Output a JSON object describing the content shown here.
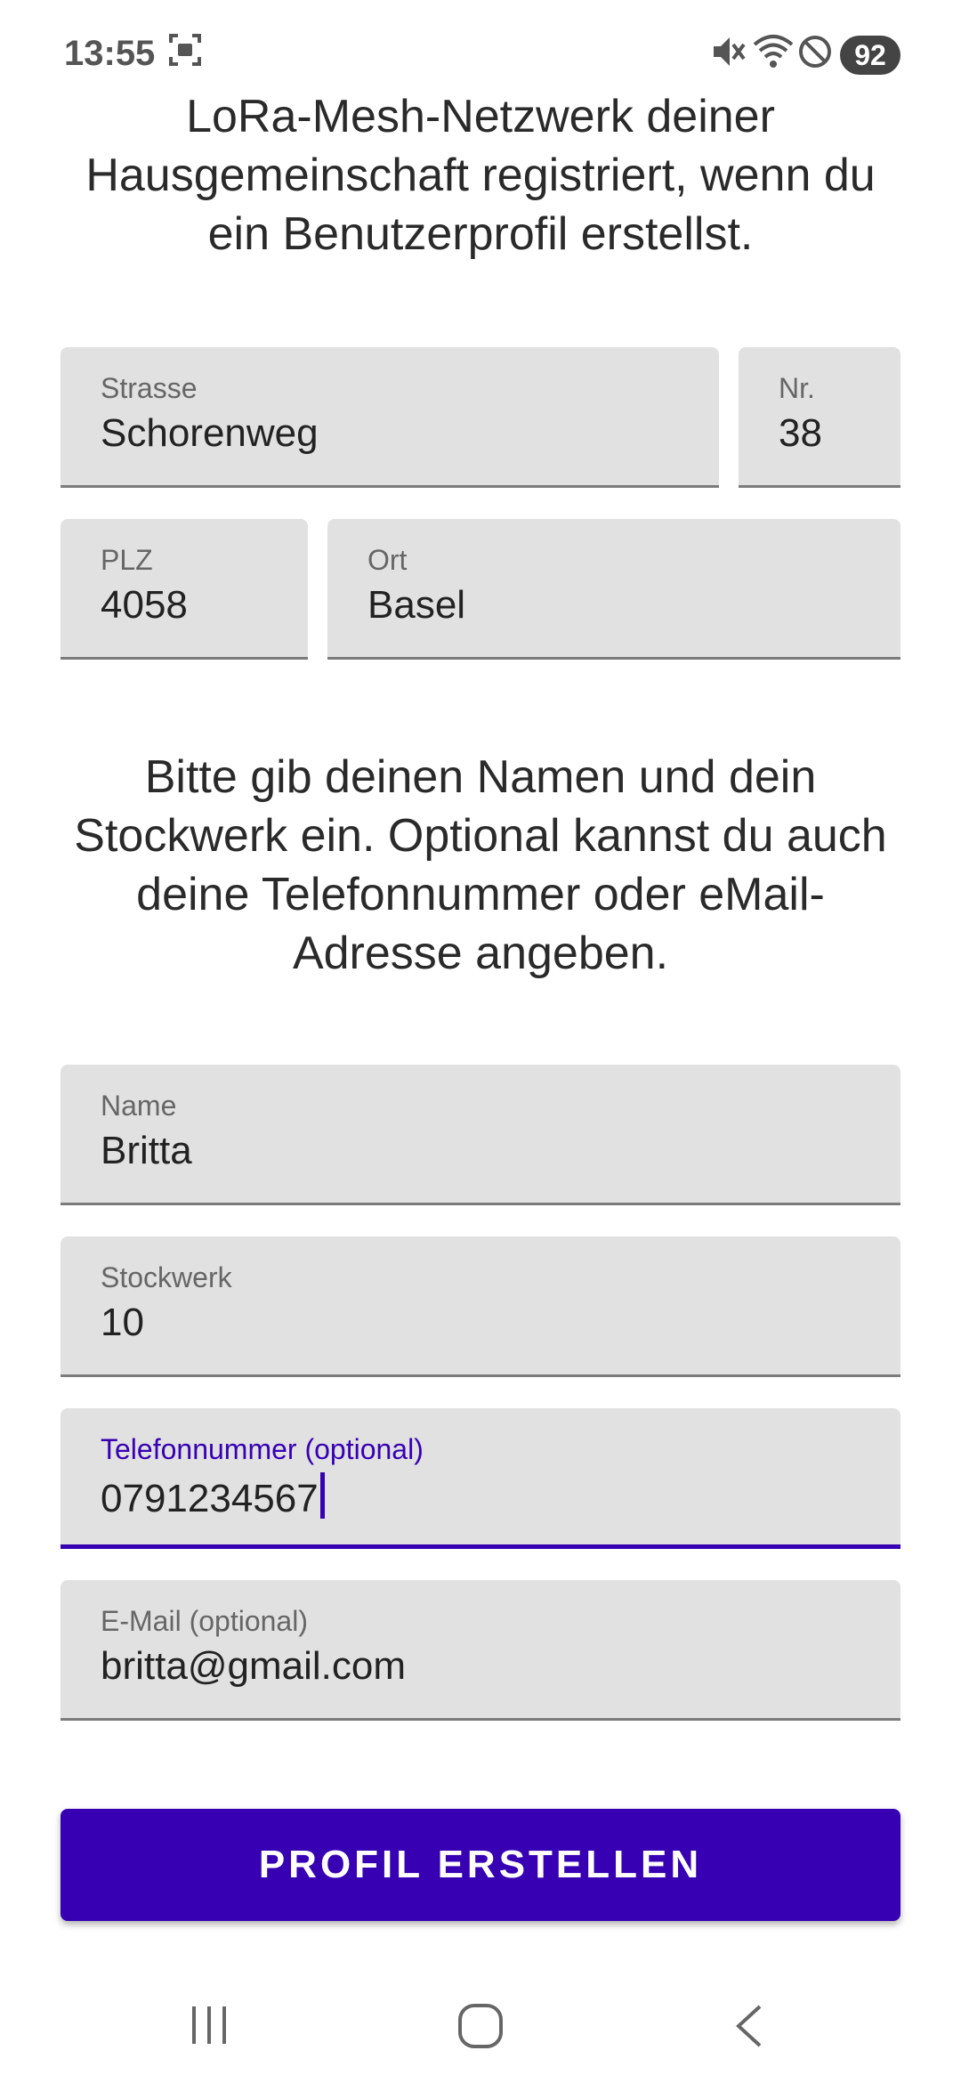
{
  "status_bar": {
    "time": "13:55",
    "battery": "92",
    "icons": [
      "screenshot-icon",
      "mute-icon",
      "wifi-icon",
      "do-not-disturb-icon"
    ]
  },
  "intro_text": "LoRa-Mesh-Netzwerk deiner Hausgemeinschaft registriert, wenn du ein Benutzerprofil erstellst.",
  "address": {
    "street": {
      "label": "Strasse",
      "value": "Schorenweg"
    },
    "number": {
      "label": "Nr.",
      "value": "38"
    },
    "zip": {
      "label": "PLZ",
      "value": "4058"
    },
    "city": {
      "label": "Ort",
      "value": "Basel"
    }
  },
  "instructions": "Bitte gib deinen Namen und dein Stockwerk ein. Optional kannst du auch deine Telefonnummer oder eMail-Adresse angeben.",
  "profile": {
    "name": {
      "label": "Name",
      "value": "Britta"
    },
    "floor": {
      "label": "Stockwerk",
      "value": "10"
    },
    "phone": {
      "label": "Telefonnummer (optional)",
      "value": "0791234567"
    },
    "email": {
      "label": "E-Mail (optional)",
      "value": "britta@gmail.com"
    }
  },
  "submit_label": "PROFIL ERSTELLEN",
  "colors": {
    "accent": "#3700b3",
    "field_bg": "#e1e1e1"
  }
}
